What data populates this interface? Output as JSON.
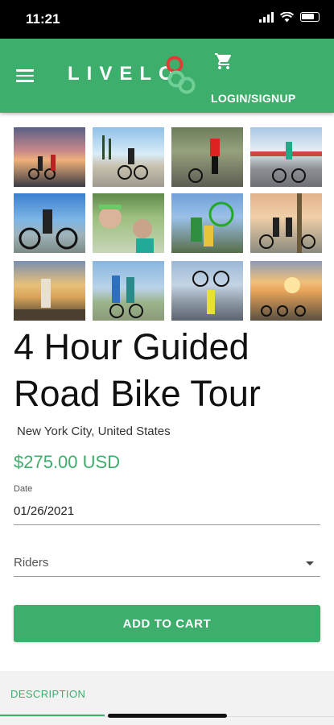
{
  "status_bar": {
    "time": "11:21"
  },
  "header": {
    "logo_text": "LIVELO",
    "login_label": "LOGIN/SIGNUP",
    "brand_color": "#3dae6b"
  },
  "gallery": {
    "photos": [
      "photo-1",
      "photo-2",
      "photo-3",
      "photo-4",
      "photo-5",
      "photo-6",
      "photo-7",
      "photo-8",
      "photo-9",
      "photo-10",
      "photo-11",
      "photo-12"
    ]
  },
  "product": {
    "title": "4 Hour Guided Road Bike Tour",
    "location": "New York City, United States",
    "price": "$275.00 USD"
  },
  "form": {
    "date_label": "Date",
    "date_value": "01/26/2021",
    "riders_placeholder": "Riders"
  },
  "actions": {
    "add_to_cart": "ADD TO CART"
  },
  "tabs": {
    "description": "DESCRIPTION"
  },
  "icons": {
    "menu": "hamburger-menu-icon",
    "cart": "shopping-cart-icon",
    "dropdown": "caret-down-icon",
    "signal": "cellular-signal-icon",
    "wifi": "wifi-icon",
    "battery": "battery-icon"
  }
}
